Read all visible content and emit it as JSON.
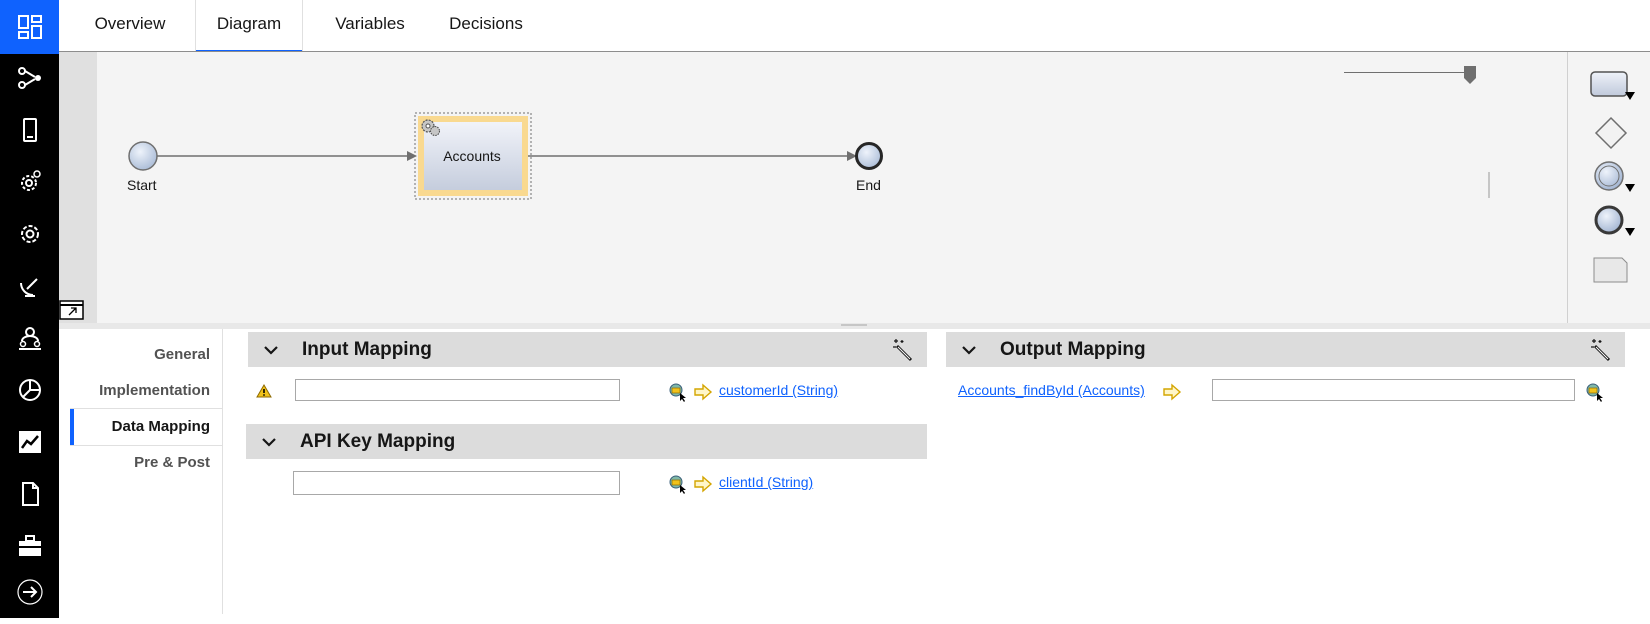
{
  "tabs": [
    {
      "label": "Overview"
    },
    {
      "label": "Diagram",
      "active": true
    },
    {
      "label": "Variables"
    },
    {
      "label": "Decisions"
    }
  ],
  "nav_icons": [
    "dashboard-icon",
    "flow-icon",
    "mobile-icon",
    "gear-badge-icon",
    "settings-icon",
    "satellite-icon",
    "users-icon",
    "pie-chart-icon",
    "line-chart-icon",
    "document-icon",
    "briefcase-icon",
    "arrow-right-icon"
  ],
  "diagram": {
    "start_label": "Start",
    "activity_label": "Accounts",
    "end_label": "End"
  },
  "side_tabs": [
    {
      "label": "General"
    },
    {
      "label": "Implementation"
    },
    {
      "label": "Data Mapping",
      "active": true
    },
    {
      "label": "Pre & Post"
    }
  ],
  "input_mapping": {
    "title": "Input Mapping",
    "row": {
      "value": "",
      "link": "customerId (String)"
    }
  },
  "api_key_mapping": {
    "title": "API Key Mapping",
    "row": {
      "value": "",
      "link": "clientId (String)"
    }
  },
  "output_mapping": {
    "title": "Output Mapping",
    "row": {
      "link": "Accounts_findById (Accounts)",
      "value": ""
    }
  },
  "colors": {
    "accent": "#0f62fe",
    "nav_bg": "#000000",
    "section_bg": "#dcdcdc",
    "selection": "#f9d990"
  }
}
